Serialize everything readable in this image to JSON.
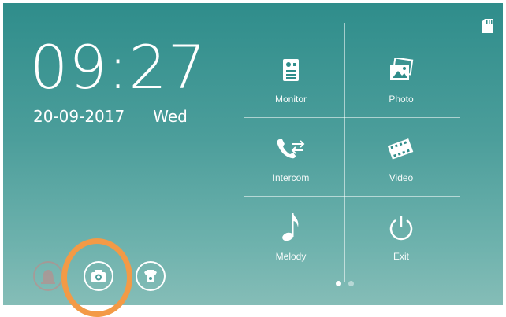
{
  "clock": {
    "time": "09:27",
    "date": "20-09-2017",
    "weekday": "Wed"
  },
  "menu": {
    "monitor": "Monitor",
    "photo": "Photo",
    "intercom": "Intercom",
    "video": "Video",
    "melody": "Melody",
    "exit": "Exit"
  },
  "pager": {
    "pages": 2,
    "active": 1
  },
  "icons": {
    "sd_card": "sd-card-icon",
    "alarm": "alarm-icon",
    "camera": "camera-icon",
    "unlock": "door-unlock-icon"
  },
  "colors": {
    "screen_top": "#2f8d8b",
    "screen_bottom": "#85bdb7",
    "highlight": "#f39a46"
  }
}
